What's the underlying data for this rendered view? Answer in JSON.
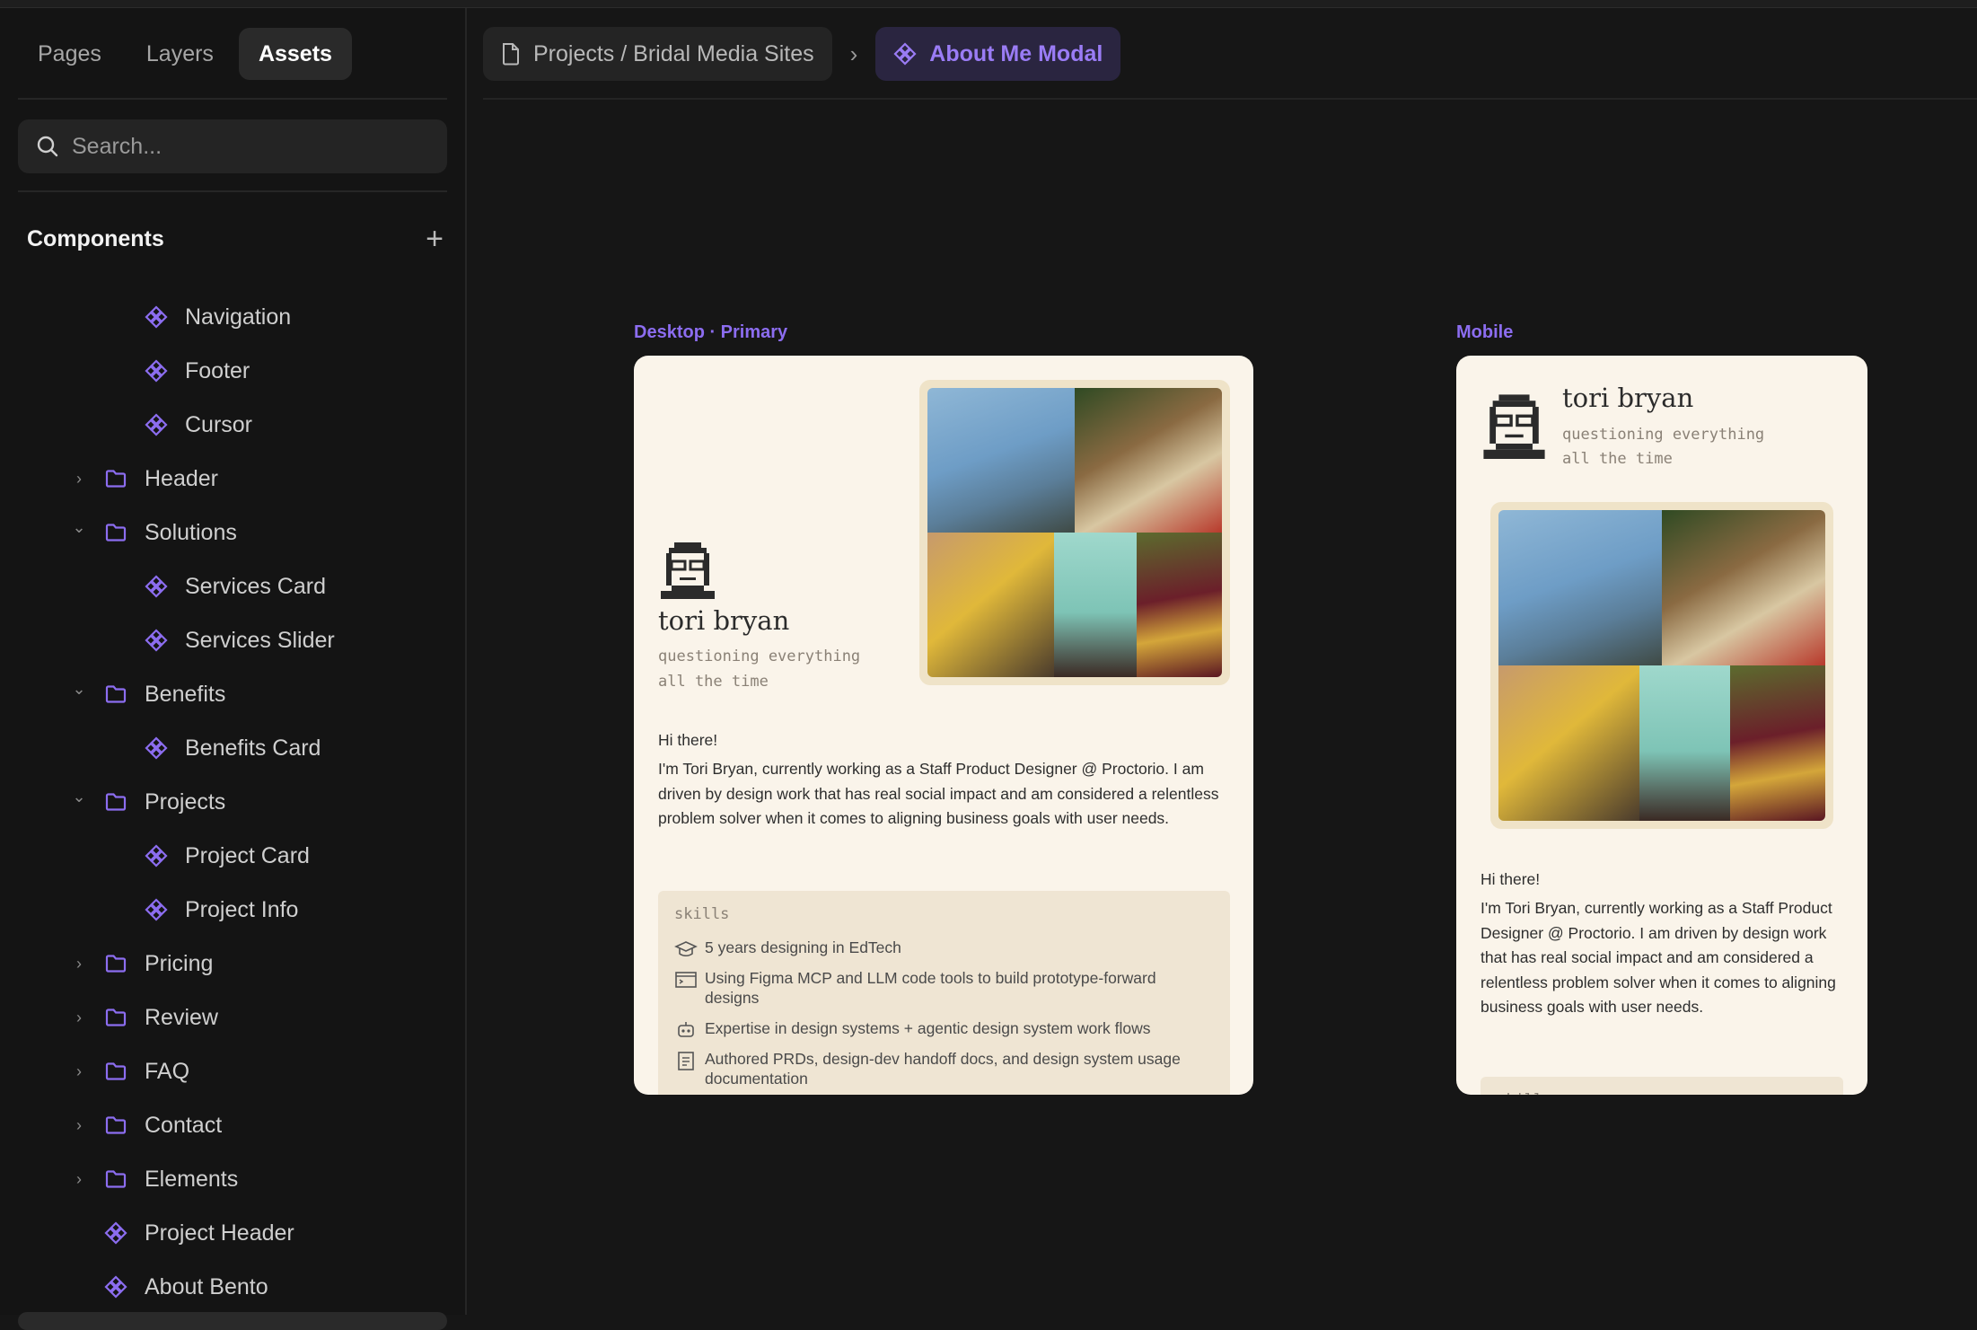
{
  "tabs": {
    "pages": "Pages",
    "layers": "Layers",
    "assets": "Assets"
  },
  "search": {
    "placeholder": "Search..."
  },
  "components": {
    "title": "Components",
    "items": [
      {
        "label": "Navigation",
        "type": "component"
      },
      {
        "label": "Footer",
        "type": "component"
      },
      {
        "label": "Cursor",
        "type": "component"
      },
      {
        "label": "Header",
        "type": "folder",
        "state": "collapsed"
      },
      {
        "label": "Solutions",
        "type": "folder",
        "state": "expanded"
      },
      {
        "label": "Services Card",
        "type": "component"
      },
      {
        "label": "Services Slider",
        "type": "component"
      },
      {
        "label": "Benefits",
        "type": "folder",
        "state": "expanded"
      },
      {
        "label": "Benefits Card",
        "type": "component"
      },
      {
        "label": "Projects",
        "type": "folder",
        "state": "expanded"
      },
      {
        "label": "Project Card",
        "type": "component"
      },
      {
        "label": "Project Info",
        "type": "component"
      },
      {
        "label": "Pricing",
        "type": "folder",
        "state": "collapsed"
      },
      {
        "label": "Review",
        "type": "folder",
        "state": "collapsed"
      },
      {
        "label": "FAQ",
        "type": "folder",
        "state": "collapsed"
      },
      {
        "label": "Contact",
        "type": "folder",
        "state": "collapsed"
      },
      {
        "label": "Elements",
        "type": "folder",
        "state": "collapsed"
      },
      {
        "label": "Project Header",
        "type": "component"
      },
      {
        "label": "About Bento",
        "type": "component"
      }
    ]
  },
  "breadcrumb": {
    "path": "Projects / Bridal Media Sites",
    "current": "About Me Modal"
  },
  "frames": {
    "desktop_label": "Desktop · Primary",
    "mobile_label": "Mobile"
  },
  "profile": {
    "name": "tori bryan",
    "tagline1": "questioning everything",
    "tagline2": "all the time",
    "greeting": "Hi there!",
    "bio": "I'm Tori Bryan, currently working as a Staff Product Designer @ Proctorio. I am driven by design work that has real social impact and am considered a relentless problem solver when it comes to aligning business goals with user needs.",
    "skills_title": "skills",
    "skills": [
      "5 years designing in EdTech",
      "Using Figma MCP and LLM code tools to build prototype-forward designs",
      "Expertise in design systems + agentic design system work flows",
      "Authored PRDs, design-dev handoff docs, and design system usage documentation"
    ]
  },
  "colors": {
    "accent": "#8c6df0",
    "card_bg": "#faf4ea",
    "sidebar_bg": "#141414",
    "skills_bg": "#efe5d3"
  }
}
